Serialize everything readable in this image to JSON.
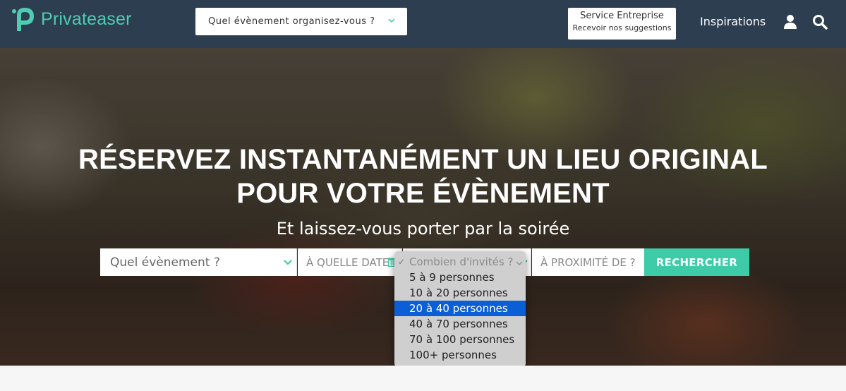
{
  "brand": {
    "name": "Privateaser",
    "accent": "#4ecdb0",
    "nav_bg": "#2c3e50"
  },
  "navbar": {
    "event_select_label": "Quel évènement organisez-vous ?",
    "service_line1": "Service Entreprise",
    "service_line2": "Recevoir nos suggestions",
    "inspirations": "Inspirations",
    "user_icon": "user-icon",
    "search_icon": "search-icon"
  },
  "hero": {
    "title_line1": "RÉSERVEZ INSTANTANÉMENT UN LIEU ORIGINAL",
    "title_line2": "POUR VOTRE ÉVÈNEMENT",
    "subtitle": "Et laissez-vous porter par la soirée"
  },
  "search": {
    "event_placeholder": "Quel évènement ?",
    "date_placeholder": "À QUELLE DATE ?",
    "guests_placeholder": "Combien d'invités ?",
    "proximity_placeholder": "À PROXIMITÉ DE ?",
    "button_label": "RECHERCHER",
    "button_color": "#3ecba7"
  },
  "guests_dropdown": {
    "options": [
      "Combien d'invités ?",
      "5 à 9 personnes",
      "10 à 20 personnes",
      "20 à 40 personnes",
      "40 à 70 personnes",
      "70 à 100 personnes",
      "100+ personnes"
    ],
    "checked_index": 0,
    "highlighted_index": 3,
    "highlight_color": "#0b5fd6"
  }
}
